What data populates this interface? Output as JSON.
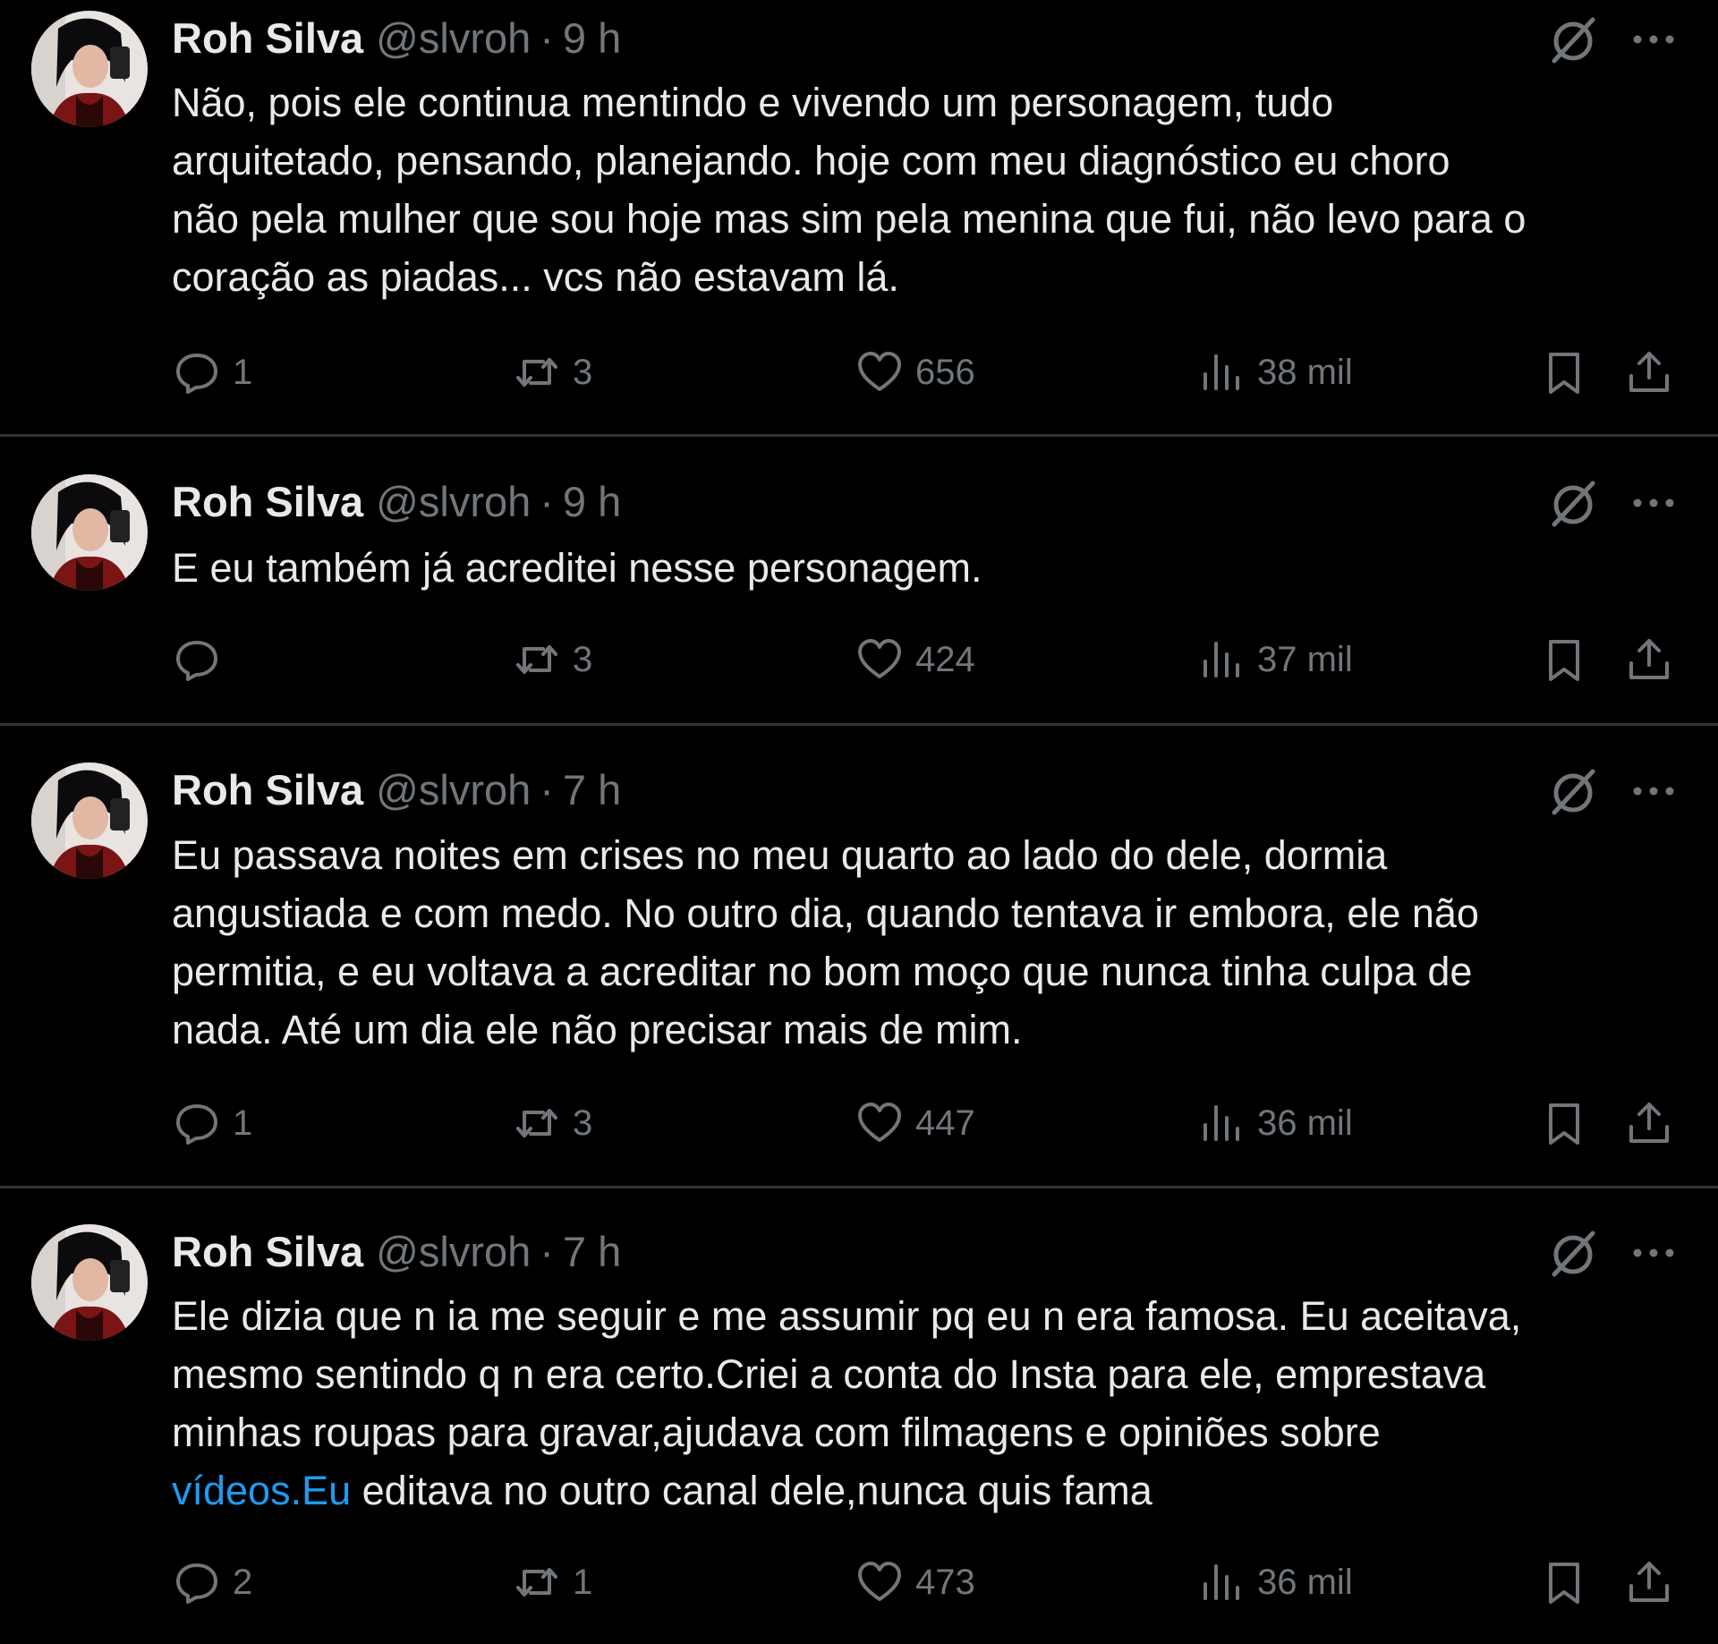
{
  "colors": {
    "background": "#000000",
    "text": "#e7e9ea",
    "muted": "#71767b",
    "link": "#1d9bf0",
    "divider": "#2f3336"
  },
  "icons": {
    "reply": "reply-icon",
    "retweet": "retweet-icon",
    "like": "heart-icon",
    "views": "views-icon",
    "bookmark": "bookmark-icon",
    "share": "share-icon",
    "grok": "grok-icon",
    "more": "more-icon"
  },
  "tweets": [
    {
      "name": "Roh Silva",
      "handle": "@slvroh",
      "sep": "·",
      "time": "9 h",
      "text": "Não, pois ele continua mentindo e vivendo um personagem, tudo\narquitetado, pensando, planejando. hoje com meu diagnóstico eu choro\nnão pela mulher que sou hoje mas sim pela menina que fui, não levo para o\ncoração as piadas... vcs não estavam lá.",
      "replies": "1",
      "retweets": "3",
      "likes": "656",
      "views": "38 mil"
    },
    {
      "name": "Roh Silva",
      "handle": "@slvroh",
      "sep": "·",
      "time": "9 h",
      "text": "E eu também já acreditei nesse personagem.",
      "replies": "",
      "retweets": "3",
      "likes": "424",
      "views": "37 mil"
    },
    {
      "name": "Roh Silva",
      "handle": "@slvroh",
      "sep": "·",
      "time": "7 h",
      "text": "Eu passava noites em crises no meu quarto ao lado do dele, dormia\nangustiada e com medo. No outro dia, quando tentava ir embora, ele não\npermitia, e eu voltava a acreditar no bom moço que nunca tinha culpa de\nnada. Até um dia ele não precisar mais de mim.",
      "replies": "1",
      "retweets": "3",
      "likes": "447",
      "views": "36 mil"
    },
    {
      "name": "Roh Silva",
      "handle": "@slvroh",
      "sep": "·",
      "time": "7 h",
      "text_before_link": "Ele dizia que n ia me seguir e me assumir pq eu n era famosa. Eu aceitava,\nmesmo sentindo q n era certo.Criei a conta do Insta para ele, emprestava\nminhas roupas para gravar,ajudava com filmagens e opiniões sobre\n",
      "link": "vídeos.Eu",
      "text_after_link": " editava no outro canal dele,nunca quis fama",
      "replies": "2",
      "retweets": "1",
      "likes": "473",
      "views": "36 mil"
    }
  ]
}
